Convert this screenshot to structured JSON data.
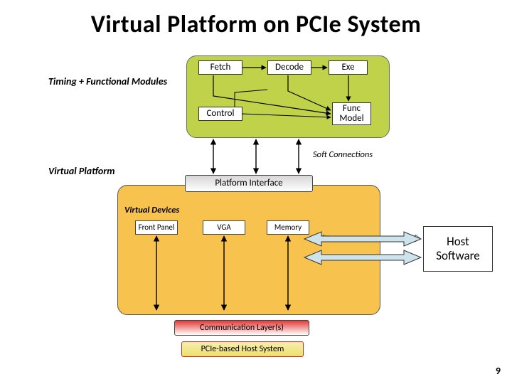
{
  "title": "Virtual Platform on PCIe System",
  "labels": {
    "timing_functional": "Timing + Functional Modules",
    "virtual_platform": "Virtual Platform",
    "virtual_devices": "Virtual Devices",
    "soft_connections": "Soft Connections"
  },
  "top": {
    "fetch": "Fetch",
    "decode": "Decode",
    "exe": "Exe",
    "control": "Control",
    "func_model": "Func\nModel"
  },
  "platform_interface": "Platform Interface",
  "devices": {
    "front_panel": "Front Panel",
    "vga": "VGA",
    "memory": "Memory"
  },
  "comm_layers": "Communication Layer(s)",
  "pcie_host": "PCIe-based Host System",
  "host_software": "Host\nSoftware",
  "page_number": "9"
}
